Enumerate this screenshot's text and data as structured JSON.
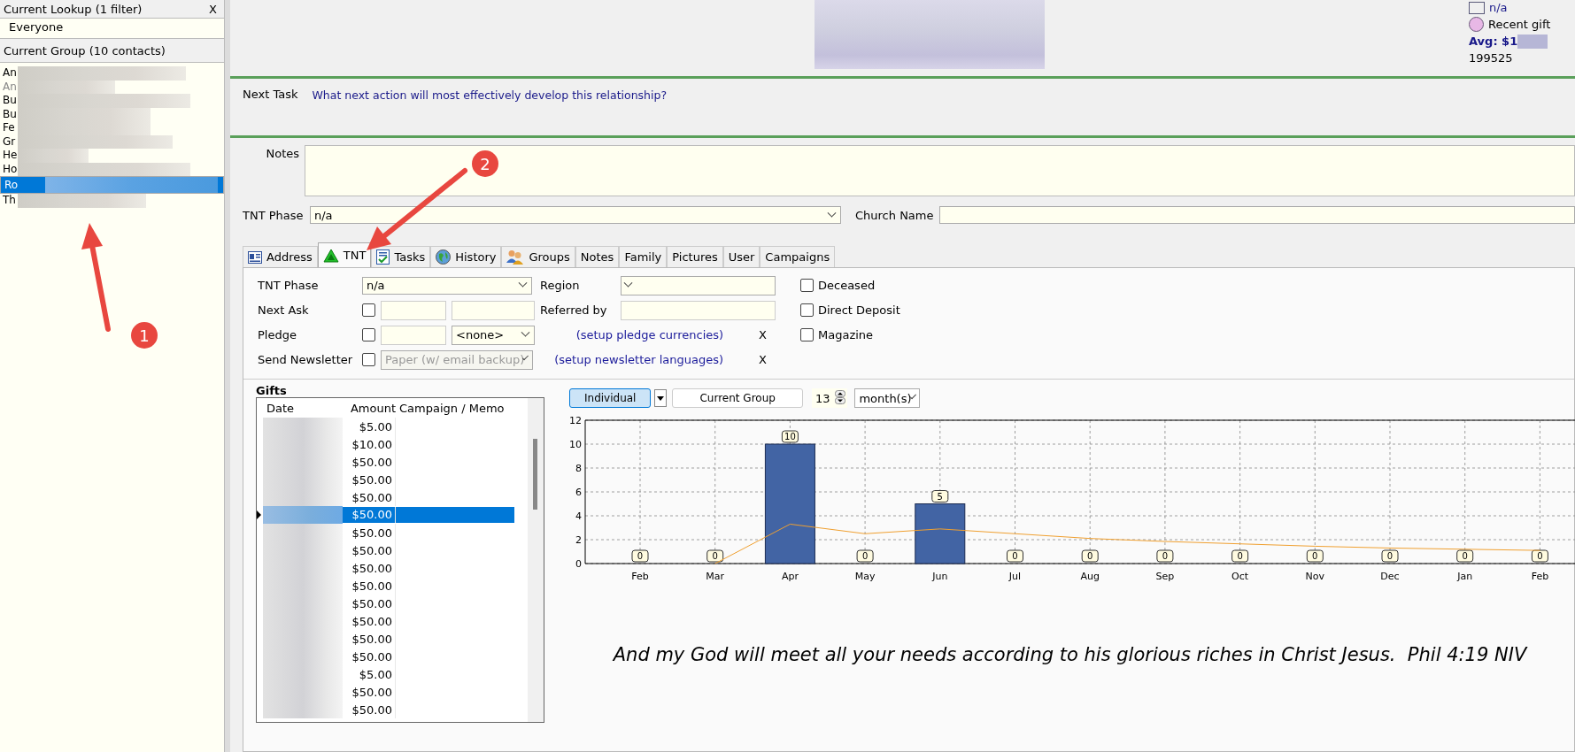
{
  "lookup": {
    "title": "Current Lookup (1 filter)",
    "close": "X",
    "filter": "Everyone"
  },
  "group": {
    "title": "Current Group (10 contacts)",
    "contacts": [
      {
        "label": "An",
        "selected": false,
        "dimmed": false
      },
      {
        "label": "An",
        "selected": false,
        "dimmed": true
      },
      {
        "label": "Bu",
        "selected": false,
        "dimmed": false
      },
      {
        "label": "Bu",
        "selected": false,
        "dimmed": false
      },
      {
        "label": "Fe",
        "selected": false,
        "dimmed": false
      },
      {
        "label": "Gr",
        "selected": false,
        "dimmed": false
      },
      {
        "label": "He",
        "selected": false,
        "dimmed": false
      },
      {
        "label": "Ho",
        "selected": false,
        "dimmed": false
      },
      {
        "label": "Ro",
        "selected": true,
        "dimmed": false
      },
      {
        "label": "Th",
        "selected": false,
        "dimmed": false
      }
    ]
  },
  "header": {
    "legend": [
      {
        "kind": "square",
        "label": "n/a"
      },
      {
        "kind": "circle",
        "label": "Recent gift"
      }
    ],
    "avg": "Avg: $1",
    "number": "199525"
  },
  "next_task": {
    "label": "Next Task",
    "text": "What next action will most effectively develop this relationship?"
  },
  "notes": {
    "label": "Notes"
  },
  "tnt_phase": {
    "label": "TNT Phase",
    "value": "n/a"
  },
  "church": {
    "label": "Church Name"
  },
  "tabs": [
    {
      "label": "Address",
      "selected": false
    },
    {
      "label": "TNT",
      "selected": true
    },
    {
      "label": "Tasks",
      "selected": false
    },
    {
      "label": "History",
      "selected": false
    },
    {
      "label": "Groups",
      "selected": false
    },
    {
      "label": "Notes",
      "selected": false
    },
    {
      "label": "Family",
      "selected": false
    },
    {
      "label": "Pictures",
      "selected": false
    },
    {
      "label": "User",
      "selected": false
    },
    {
      "label": "Campaigns",
      "selected": false
    }
  ],
  "tnt_form": {
    "phase": {
      "label": "TNT Phase",
      "value": "n/a"
    },
    "next_ask": {
      "label": "Next Ask",
      "checked": false
    },
    "pledge": {
      "label": "Pledge",
      "checked": false,
      "currency": "<none>"
    },
    "newsletter": {
      "label": "Send Newsletter",
      "checked": false,
      "value": "Paper (w/ email backup)",
      "disabled": true
    },
    "region": {
      "label": "Region"
    },
    "referred_by": {
      "label": "Referred by"
    },
    "links": [
      {
        "text": "(setup pledge currencies)",
        "close": "X"
      },
      {
        "text": "(setup newsletter languages)",
        "close": "X"
      }
    ],
    "flags": [
      {
        "label": "Deceased",
        "checked": false
      },
      {
        "label": "Direct Deposit",
        "checked": false
      },
      {
        "label": "Magazine",
        "checked": false
      }
    ]
  },
  "gifts": {
    "title": "Gifts",
    "columns": [
      "Date",
      "Amount",
      "Campaign / Memo"
    ],
    "rows": [
      {
        "amount": "$5.00",
        "selected": false
      },
      {
        "amount": "$10.00",
        "selected": false
      },
      {
        "amount": "$50.00",
        "selected": false
      },
      {
        "amount": "$50.00",
        "selected": false
      },
      {
        "amount": "$50.00",
        "selected": false
      },
      {
        "amount": "$50.00",
        "selected": true
      },
      {
        "amount": "$50.00",
        "selected": false
      },
      {
        "amount": "$50.00",
        "selected": false
      },
      {
        "amount": "$50.00",
        "selected": false
      },
      {
        "amount": "$50.00",
        "selected": false
      },
      {
        "amount": "$50.00",
        "selected": false
      },
      {
        "amount": "$50.00",
        "selected": false
      },
      {
        "amount": "$50.00",
        "selected": false
      },
      {
        "amount": "$50.00",
        "selected": false
      },
      {
        "amount": "$5.00",
        "selected": false
      },
      {
        "amount": "$50.00",
        "selected": false
      },
      {
        "amount": "$50.00",
        "selected": false
      }
    ]
  },
  "chart_controls": {
    "modes": [
      {
        "label": "Individual",
        "selected": true
      },
      {
        "label": "Current Group",
        "selected": false
      }
    ],
    "count": "13",
    "unit": "month(s)"
  },
  "chart_data": {
    "type": "bar",
    "categories": [
      "Feb",
      "Mar",
      "Apr",
      "May",
      "Jun",
      "Jul",
      "Aug",
      "Sep",
      "Oct",
      "Nov",
      "Dec",
      "Jan",
      "Feb"
    ],
    "ylim": [
      0,
      12
    ],
    "yticks": [
      0,
      2,
      4,
      6,
      8,
      10,
      12
    ],
    "grid": true,
    "series": [
      {
        "color": "#4264a4",
        "values": [
          0,
          0,
          10,
          0,
          5,
          0,
          0,
          0,
          0,
          0,
          0,
          0,
          0
        ],
        "value_labels": [
          "0",
          "0",
          "10",
          "0",
          "5",
          "0",
          "0",
          "0",
          "0",
          "0",
          "0",
          "0",
          "0"
        ]
      },
      {
        "type": "line",
        "color": "#f0a030",
        "values": [
          null,
          0,
          3.3,
          2.5,
          2.9,
          2.5,
          2.1,
          1.85,
          1.65,
          1.45,
          1.3,
          1.2,
          1.1
        ]
      }
    ]
  },
  "quote": "And my God will meet all your needs according to his glorious riches in Christ Jesus.  Phil 4:19 NIV",
  "annotations": [
    {
      "number": "1"
    },
    {
      "number": "2"
    }
  ]
}
